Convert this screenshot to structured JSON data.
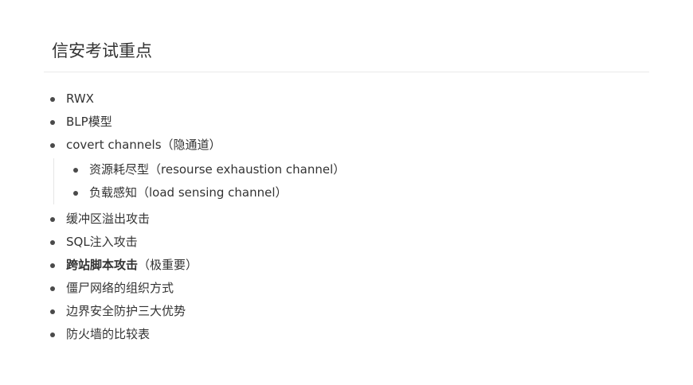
{
  "document": {
    "title": "信安考试重点"
  },
  "items": [
    {
      "label": "RWX"
    },
    {
      "label": "BLP模型"
    },
    {
      "label": "covert channels（隐通道）",
      "children": [
        {
          "label": "资源耗尽型（resourse exhaustion channel）"
        },
        {
          "label": "负载感知（load sensing channel）"
        }
      ]
    },
    {
      "label": "缓冲区溢出攻击"
    },
    {
      "label": "SQL注入攻击"
    },
    {
      "label_bold": "跨站脚本攻击",
      "label_note": "（极重要）"
    },
    {
      "label": "僵尸网络的组织方式"
    },
    {
      "label": "边界安全防护三大优势"
    },
    {
      "label": "防火墙的比较表"
    }
  ]
}
